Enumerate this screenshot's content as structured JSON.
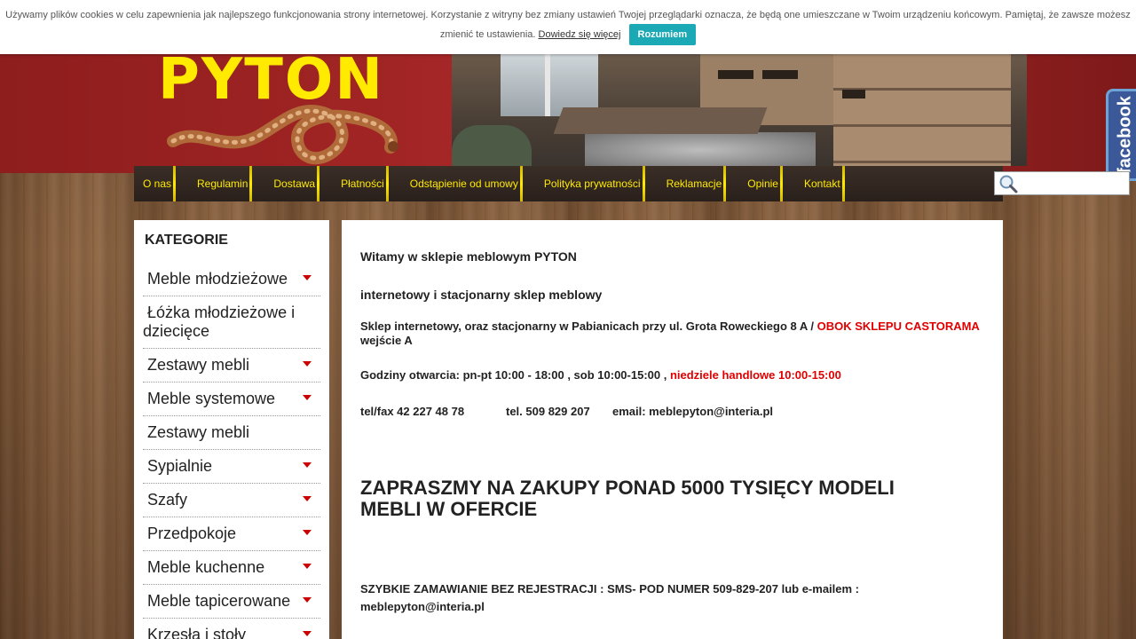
{
  "cookie": {
    "text_line1": "Używamy plików cookies w celu zapewnienia jak najlepszego funkcjonowania strony internetowej. Korzystanie z witryny bez zmiany ustawień Twojej przeglądarki oznacza, że będą one umieszczane w Twoim urządzeniu końcowym. Pamiętaj, że zawsze możesz",
    "text_line2": "zmienić te ustawienia.",
    "link": "Dowiedz się więcej",
    "button": "Rozumiem"
  },
  "header": {
    "logo_text": "PYTON"
  },
  "facebook": {
    "label": "facebook"
  },
  "nav": {
    "items": [
      "O nas",
      "Regulamin",
      "Dostawa",
      "Płatności",
      "Odstąpienie od umowy",
      "Polityka prywatności",
      "Reklamacje",
      "Opinie",
      "Kontakt"
    ],
    "search_placeholder": ""
  },
  "sidebar": {
    "title": "KATEGORIE",
    "items": [
      {
        "label": "Meble młodzieżowe",
        "arrow": true
      },
      {
        "label": "Łóżka młodzieżowe i",
        "label2": "dziecięce",
        "arrow": false
      },
      {
        "label": "Zestawy mebli",
        "arrow": true
      },
      {
        "label": "Meble systemowe",
        "arrow": true
      },
      {
        "label": "Zestawy mebli",
        "arrow": false
      },
      {
        "label": "Sypialnie",
        "arrow": true
      },
      {
        "label": "Szafy",
        "arrow": true
      },
      {
        "label": "Przedpokoje",
        "arrow": true
      },
      {
        "label": "Meble kuchenne",
        "arrow": true
      },
      {
        "label": "Meble tapicerowane",
        "arrow": true
      },
      {
        "label": "Krzesła i stoły",
        "arrow": true
      }
    ]
  },
  "content": {
    "welcome": "Witamy w sklepie meblowym PYTON",
    "subtitle": "internetowy i stacjonarny sklep meblowy",
    "address_prefix": "Sklep internetowy, oraz stacjonarny w Pabianicach przy ul. Grota Roweckiego 8 A / ",
    "address_red": "OBOK SKLEPU CASTORAMA",
    "address_red2": "wejście A",
    "hours_prefix": "Godziny otwarcia:  pn-pt 10:00 - 18:00  , sob 10:00-15:00 , ",
    "hours_red": "niedziele handlowe 10:00-15:00",
    "phone1": "tel/fax 42 227 48 78",
    "phone2": "tel. 509 829 207",
    "email": "email: meblepyton@interia.pl",
    "headline1": "ZAPRASZMY NA ZAKUPY PONAD 5000 TYSIĘCY MODELI",
    "headline2": "MEBLI W OFERCIE",
    "order1": "SZYBKIE ZAMAWIANIE BEZ REJESTRACJI : SMS- POD NUMER 509-829-207 lub e-mailem :",
    "order2": "meblepyton@interia.pl"
  }
}
